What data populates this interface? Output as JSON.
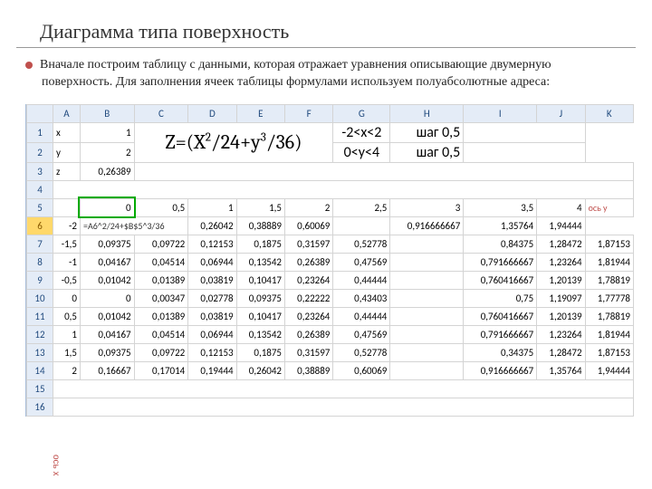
{
  "title": "Диаграмма типа поверхность",
  "bodyText": "Вначале построим таблицу с данными, которая отражает уравнения описывающие двумерную поверхность. Для заполнения ячеек таблицы формулами используем полуабсолютные адреса:",
  "cols": [
    "A",
    "B",
    "C",
    "D",
    "E",
    "F",
    "G",
    "H",
    "I",
    "J",
    "K"
  ],
  "rows": [
    "1",
    "2",
    "3",
    "4",
    "5",
    "6",
    "7",
    "8",
    "9",
    "10",
    "11",
    "12",
    "13",
    "14",
    "15",
    "16"
  ],
  "r1": {
    "x": "x",
    "xv": "1",
    "cond": "-2<x<2",
    "step": "шаг 0,5"
  },
  "r2": {
    "y": "y",
    "yv": "2",
    "cond": "0<y<4",
    "step": "шаг 0,5"
  },
  "r3": {
    "z": "z",
    "zv": "0,26389"
  },
  "formula": "Z=(X²/24+y³/36)",
  "formulaCell": "=A6^2/24+$B$5^3/36",
  "hdr": [
    "0",
    "0,5",
    "1",
    "1,5",
    "2",
    "2,5",
    "3",
    "3,5",
    "4"
  ],
  "axisY": "ось y",
  "axisX": "ось x",
  "d": [
    [
      "-2",
      "",
      "",
      "0,26042",
      "0,38889",
      "0,60069",
      "",
      "0,916666667",
      "1,35764",
      "1,94444"
    ],
    [
      "-1,5",
      "0,09375",
      "0,09722",
      "0,12153",
      "0,1875",
      "0,31597",
      "0,52778",
      "0,84375",
      "1,28472",
      "1,87153"
    ],
    [
      "-1",
      "0,04167",
      "0,04514",
      "0,06944",
      "0,13542",
      "0,26389",
      "0,47569",
      "0,791666667",
      "1,23264",
      "1,81944"
    ],
    [
      "-0,5",
      "0,01042",
      "0,01389",
      "0,03819",
      "0,10417",
      "0,23264",
      "0,44444",
      "0,760416667",
      "1,20139",
      "1,78819"
    ],
    [
      "0",
      "0",
      "0,00347",
      "0,02778",
      "0,09375",
      "0,22222",
      "0,43403",
      "0,75",
      "1,19097",
      "1,77778"
    ],
    [
      "0,5",
      "0,01042",
      "0,01389",
      "0,03819",
      "0,10417",
      "0,23264",
      "0,44444",
      "0,760416667",
      "1,20139",
      "1,78819"
    ],
    [
      "1",
      "0,04167",
      "0,04514",
      "0,06944",
      "0,13542",
      "0,26389",
      "0,47569",
      "0,791666667",
      "1,23264",
      "1,81944"
    ],
    [
      "1,5",
      "0,09375",
      "0,09722",
      "0,12153",
      "0,1875",
      "0,31597",
      "0,52778",
      "0,34375",
      "1,28472",
      "1,87153"
    ],
    [
      "2",
      "0,16667",
      "0,17014",
      "0,19444",
      "0,26042",
      "0,38889",
      "0,60069",
      "0,916666667",
      "1,35764",
      "1,94444"
    ]
  ]
}
